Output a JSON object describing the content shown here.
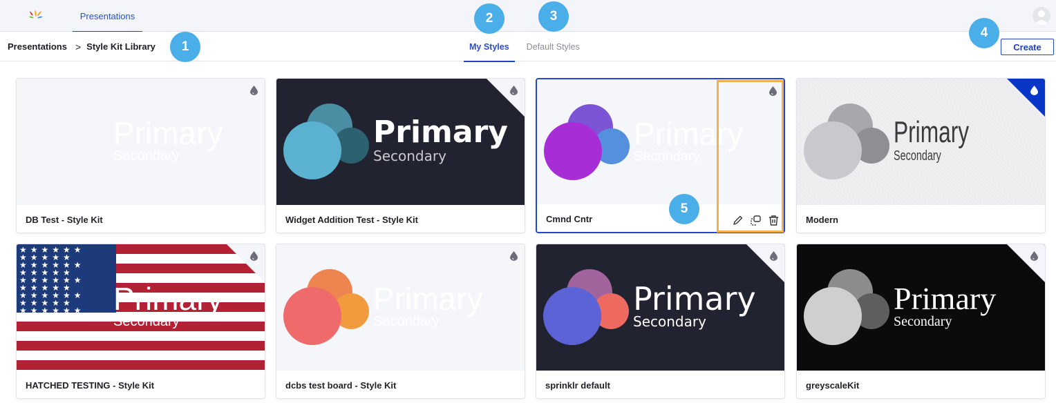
{
  "topnav": {
    "logo": "sprinklr-logo",
    "active_tab": "Presentations",
    "avatar": "user-avatar-icon"
  },
  "subheader": {
    "breadcrumb": {
      "root": "Presentations",
      "separator": ">",
      "current": "Style Kit Library"
    },
    "tabs": [
      {
        "label": "My Styles",
        "active": true
      },
      {
        "label": "Default Styles",
        "active": false
      }
    ],
    "create_label": "Create"
  },
  "callouts": [
    "1",
    "2",
    "3",
    "4",
    "5"
  ],
  "colors": {
    "accent": "#1e40cc",
    "callout": "#4aaee8",
    "highlight": "#f2b14f",
    "selected_corner": "#0837c8"
  },
  "style_kits": [
    {
      "name": "DB Test - Style Kit",
      "primary": "Primary",
      "secondary": "Secondary",
      "background": "#f5f6fa",
      "circles": [],
      "text_color": "#ffffff",
      "selected": false,
      "default": false
    },
    {
      "name": "Widget Addition Test - Style Kit",
      "primary": "Primary",
      "secondary": "Secondary",
      "background": "#222330",
      "circles": [
        "#4a8ea4",
        "#2c6170",
        "#5ab2d0"
      ],
      "text_color": "#ffffff",
      "selected": false,
      "default": false
    },
    {
      "name": "Cmnd Cntr",
      "primary": "Primary",
      "secondary": "Secondary",
      "background": "#f5f6fa",
      "circles": [
        "#7c55d6",
        "#5590de",
        "#a72ed6"
      ],
      "text_color": "#ffffff",
      "selected": true,
      "default": false,
      "actions": [
        {
          "name": "edit-icon"
        },
        {
          "name": "duplicate-icon"
        },
        {
          "name": "delete-icon"
        }
      ]
    },
    {
      "name": "Modern",
      "primary": "Primary",
      "secondary": "Secondary",
      "background": "#f0f0f2",
      "circles": [
        "#a8a8ac",
        "#8e8e93",
        "#c9c9cd"
      ],
      "text_color": "#3a3a3a",
      "selected": false,
      "default": true
    },
    {
      "name": "HATCHED TESTING - Style Kit",
      "primary": "Primary",
      "secondary": "Secondary",
      "background": "flag",
      "circles": [],
      "text_color": "#ffffff",
      "selected": false,
      "default": false
    },
    {
      "name": "dcbs test board - Style Kit",
      "primary": "Primary",
      "secondary": "Secondary",
      "background": "#f5f6fa",
      "circles": [
        "#ee8450",
        "#f29a3e",
        "#ef6a6a"
      ],
      "text_color": "#ffffff",
      "selected": false,
      "default": false
    },
    {
      "name": "sprinklr default",
      "primary": "Primary",
      "secondary": "Secondary",
      "background": "#222330",
      "circles": [
        "#a2649c",
        "#ee6a60",
        "#5c63d6"
      ],
      "text_color": "#ffffff",
      "selected": false,
      "default": false
    },
    {
      "name": "greyscaleKit",
      "primary": "Primary",
      "secondary": "Secondary",
      "background": "#0b0b0c",
      "circles": [
        "#8c8c8c",
        "#5e5e5e",
        "#cfcfcf"
      ],
      "text_color": "#ffffff",
      "selected": false,
      "default": false
    }
  ]
}
